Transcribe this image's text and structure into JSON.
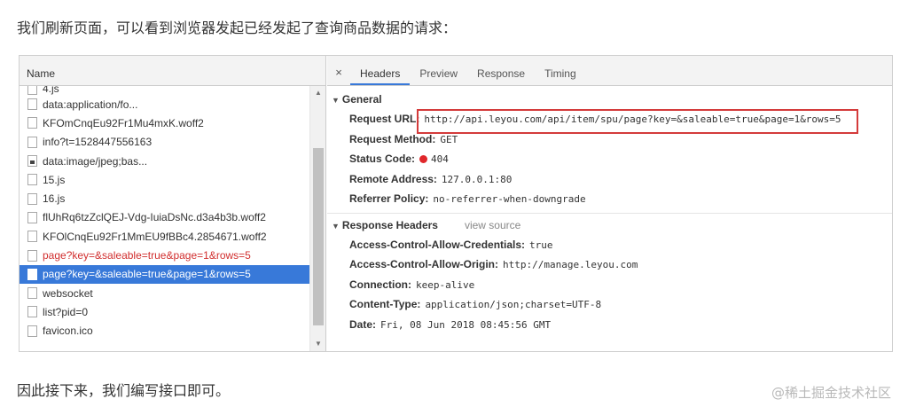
{
  "intro_text": "我们刷新页面，可以看到浏览器发起已经发起了查询商品数据的请求：",
  "outro_text": "因此接下来，我们编写接口即可。",
  "watermark": "@稀土掘金技术社区",
  "list": {
    "header": "Name",
    "items": [
      {
        "label": "4.js",
        "state": "normal",
        "icon": "file-icon"
      },
      {
        "label": "data:application/fo...",
        "state": "normal",
        "icon": "file-icon"
      },
      {
        "label": "KFOmCnqEu92Fr1Mu4mxK.woff2",
        "state": "normal",
        "icon": "file-icon"
      },
      {
        "label": "info?t=1528447556163",
        "state": "normal",
        "icon": "file-icon"
      },
      {
        "label": "data:image/jpeg;bas...",
        "state": "normal",
        "icon": "image-file-icon"
      },
      {
        "label": "15.js",
        "state": "normal",
        "icon": "file-icon"
      },
      {
        "label": "16.js",
        "state": "normal",
        "icon": "file-icon"
      },
      {
        "label": "flUhRq6tzZclQEJ-Vdg-IuiaDsNc.d3a4b3b.woff2",
        "state": "normal",
        "icon": "file-icon"
      },
      {
        "label": "KFOlCnqEu92Fr1MmEU9fBBc4.2854671.woff2",
        "state": "normal",
        "icon": "file-icon"
      },
      {
        "label": "page?key=&saleable=true&page=1&rows=5",
        "state": "error",
        "icon": "file-icon"
      },
      {
        "label": "page?key=&saleable=true&page=1&rows=5",
        "state": "selected",
        "icon": "file-icon"
      },
      {
        "label": "websocket",
        "state": "normal",
        "icon": "file-icon"
      },
      {
        "label": "list?pid=0",
        "state": "normal",
        "icon": "file-icon"
      },
      {
        "label": "favicon.ico",
        "state": "normal",
        "icon": "file-icon"
      }
    ]
  },
  "tabs": {
    "close": "×",
    "items": [
      {
        "label": "Headers",
        "active": true
      },
      {
        "label": "Preview",
        "active": false
      },
      {
        "label": "Response",
        "active": false
      },
      {
        "label": "Timing",
        "active": false
      }
    ]
  },
  "general": {
    "title": "General",
    "request_url_key": "Request URL:",
    "request_url": "http://api.leyou.com/api/item/spu/page?key=&saleable=true&page=1&rows=5",
    "request_method_key": "Request Method:",
    "request_method": "GET",
    "status_code_key": "Status Code:",
    "status_code": "404",
    "remote_address_key": "Remote Address:",
    "remote_address": "127.0.0.1:80",
    "referrer_policy_key": "Referrer Policy:",
    "referrer_policy": "no-referrer-when-downgrade"
  },
  "response_headers": {
    "title": "Response Headers",
    "view_source": "view source",
    "items": [
      {
        "key": "Access-Control-Allow-Credentials:",
        "value": "true"
      },
      {
        "key": "Access-Control-Allow-Origin:",
        "value": "http://manage.leyou.com"
      },
      {
        "key": "Connection:",
        "value": "keep-alive"
      },
      {
        "key": "Content-Type:",
        "value": "application/json;charset=UTF-8"
      },
      {
        "key": "Date:",
        "value": "Fri, 08 Jun 2018 08:45:56 GMT"
      }
    ]
  },
  "colors": {
    "selected_row": "#3879d9",
    "error_text": "#d12e2e",
    "status_dot": "#e0272b",
    "highlight_box": "#d43b3b"
  }
}
